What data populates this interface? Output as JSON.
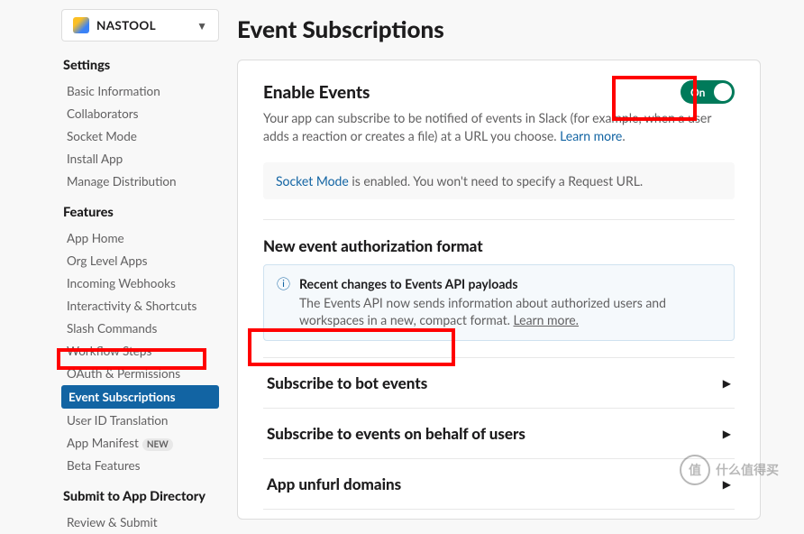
{
  "app": {
    "name": "NASTOOL"
  },
  "sidebar": {
    "sections": [
      {
        "title": "Settings",
        "items": [
          "Basic Information",
          "Collaborators",
          "Socket Mode",
          "Install App",
          "Manage Distribution"
        ]
      },
      {
        "title": "Features",
        "items": [
          "App Home",
          "Org Level Apps",
          "Incoming Webhooks",
          "Interactivity & Shortcuts",
          "Slash Commands",
          "Workflow Steps",
          "OAuth & Permissions",
          "Event Subscriptions",
          "User ID Translation",
          "App Manifest",
          "Beta Features"
        ],
        "badge_index": 9,
        "badge_text": "NEW",
        "active_index": 7
      },
      {
        "title": "Submit to App Directory",
        "items": [
          "Review & Submit"
        ]
      }
    ]
  },
  "page": {
    "title": "Event Subscriptions",
    "enable": {
      "title": "Enable Events",
      "desc_prefix": "Your app can subscribe to be notified of events in Slack (for example, when a user adds a reaction or creates a file) at a URL you choose. ",
      "learn_more": "Learn more",
      "toggle_label": "On"
    },
    "socket_strip": {
      "link": "Socket Mode",
      "text": " is enabled. You won't need to specify a Request URL."
    },
    "auth_format": {
      "title": "New event authorization format",
      "box_title": "Recent changes to Events API payloads",
      "box_text": "The Events API now sends information about authorized users and workspaces in a new, compact format. ",
      "learn_more": "Learn more."
    },
    "accordions": [
      "Subscribe to bot events",
      "Subscribe to events on behalf of users",
      "App unfurl domains"
    ]
  },
  "watermark": {
    "circle": "值",
    "text": "什么值得买"
  }
}
